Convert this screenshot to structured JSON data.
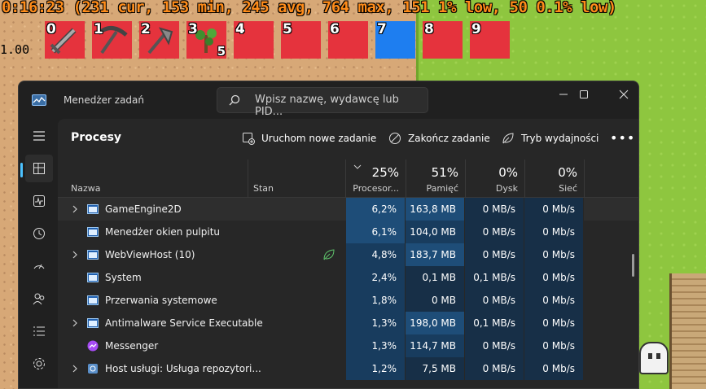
{
  "game": {
    "fps_text": "0:16:23 (231 cur, 153 min, 245 avg, 764 max, 151 1% low, 50 0.1% low)",
    "left_hud_text": "1.00",
    "hotbar": [
      {
        "num": "0",
        "item": "sword-icon",
        "count": ""
      },
      {
        "num": "1",
        "item": "pickaxe-icon",
        "count": ""
      },
      {
        "num": "2",
        "item": "axe-icon",
        "count": ""
      },
      {
        "num": "3",
        "item": "sapling-icon",
        "count": "5"
      },
      {
        "num": "4",
        "item": "",
        "count": ""
      },
      {
        "num": "5",
        "item": "",
        "count": ""
      },
      {
        "num": "6",
        "item": "",
        "count": ""
      },
      {
        "num": "7",
        "item": "",
        "count": "",
        "selected": true
      },
      {
        "num": "8",
        "item": "",
        "count": ""
      },
      {
        "num": "9",
        "item": "",
        "count": ""
      }
    ],
    "colors": {
      "slot": "#e5333d",
      "selected_slot": "#1e7ef0",
      "fps_text": "#ff8c1a",
      "grass": "#8ec63f",
      "sand": "#d7a877"
    }
  },
  "taskmanager": {
    "title": "Menedżer zadań",
    "search_placeholder": "Wpisz nazwę, wydawcę lub PID...",
    "page_title": "Procesy",
    "toolbar": {
      "new_task": "Uruchom nowe zadanie",
      "end_task": "Zakończ zadanie",
      "efficiency": "Tryb wydajności",
      "more": "•••"
    },
    "columns": {
      "name": "Nazwa",
      "status": "Stan",
      "cpu": {
        "pct": "25%",
        "label": "Procesor..."
      },
      "memory": {
        "pct": "51%",
        "label": "Pamięć"
      },
      "disk": {
        "pct": "0%",
        "label": "Dysk"
      },
      "network": {
        "pct": "0%",
        "label": "Sieć"
      }
    },
    "processes": [
      {
        "name": "GameEngine2D",
        "expandable": true,
        "icon": "window-icon",
        "cpu": "6,2%",
        "memory": "163,8 MB",
        "disk": "0 MB/s",
        "network": "0 Mb/s"
      },
      {
        "name": "Menedżer okien pulpitu",
        "expandable": false,
        "icon": "window-icon",
        "cpu": "6,1%",
        "memory": "104,0 MB",
        "disk": "0 MB/s",
        "network": "0 Mb/s"
      },
      {
        "name": "WebViewHost (10)",
        "expandable": true,
        "icon": "window-icon",
        "status_icon": "leaf-icon",
        "cpu": "4,8%",
        "memory": "183,7 MB",
        "disk": "0 MB/s",
        "network": "0 Mb/s"
      },
      {
        "name": "System",
        "expandable": false,
        "icon": "window-icon",
        "cpu": "2,4%",
        "memory": "0,1 MB",
        "disk": "0,1 MB/s",
        "network": "0 Mb/s"
      },
      {
        "name": "Przerwania systemowe",
        "expandable": false,
        "icon": "window-icon",
        "cpu": "1,8%",
        "memory": "0 MB",
        "disk": "0 MB/s",
        "network": "0 Mb/s"
      },
      {
        "name": "Antimalware Service Executable",
        "expandable": true,
        "icon": "window-icon",
        "cpu": "1,3%",
        "memory": "198,0 MB",
        "disk": "0,1 MB/s",
        "network": "0 Mb/s"
      },
      {
        "name": "Messenger",
        "expandable": false,
        "icon": "messenger-icon",
        "cpu": "1,3%",
        "memory": "114,7 MB",
        "disk": "0 MB/s",
        "network": "0 Mb/s"
      },
      {
        "name": "Host usługi: Usługa repozytori...",
        "expandable": true,
        "icon": "gear-icon",
        "cpu": "1,2%",
        "memory": "7,5 MB",
        "disk": "0 MB/s",
        "network": "0 Mb/s"
      }
    ],
    "colors": {
      "bg": "#202020",
      "content": "#272727",
      "heat_high": "#1e4d78",
      "heat_mid": "#183c5e",
      "heat_low": "#172f47",
      "accent": "#4cc2ff"
    }
  }
}
